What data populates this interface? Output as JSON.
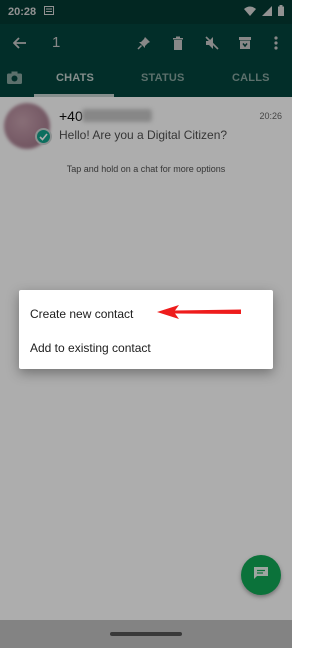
{
  "status_bar": {
    "time": "20:28",
    "icons": [
      "message-notification-icon",
      "wifi-icon",
      "signal-icon",
      "battery-icon"
    ]
  },
  "app_bar": {
    "selected_count": "1",
    "icons": [
      "back-arrow-icon",
      "pin-icon",
      "delete-icon",
      "mute-icon",
      "archive-icon",
      "more-vert-icon"
    ]
  },
  "tabs": {
    "items": [
      {
        "label": "CHATS",
        "active": true
      },
      {
        "label": "STATUS",
        "active": false
      },
      {
        "label": "CALLS",
        "active": false
      }
    ]
  },
  "chat": {
    "name_prefix": "+40",
    "time": "20:26",
    "message": "Hello! Are you a Digital Citizen?"
  },
  "hint": "Tap and hold on a chat for more options",
  "dialog": {
    "options": [
      "Create new contact",
      "Add to existing contact"
    ]
  },
  "colors": {
    "header": "#04453d",
    "accent": "#11a856",
    "check": "#12a38b",
    "arrow": "#ee1c1c"
  }
}
